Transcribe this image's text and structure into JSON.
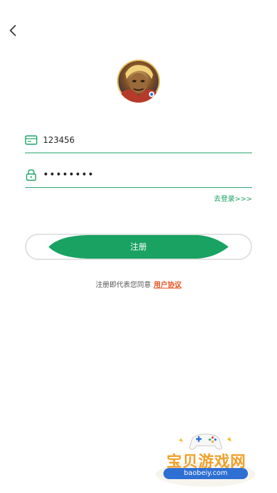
{
  "header": {
    "back_icon": "chevron-left-icon"
  },
  "avatar": {
    "icon": "user-avatar-image"
  },
  "form": {
    "username": {
      "icon": "id-card-icon",
      "value": "123456"
    },
    "password": {
      "icon": "lock-icon",
      "value": "••••••••"
    },
    "goto_login": "去登录>>>",
    "register_label": "注册"
  },
  "agreement": {
    "text": "注册即代表您同意",
    "link": "用户协议"
  },
  "watermark": {
    "title": "宝贝游戏网",
    "url": "baobeiy.com"
  },
  "colors": {
    "accent": "#19a262",
    "link": "#e6501e"
  }
}
